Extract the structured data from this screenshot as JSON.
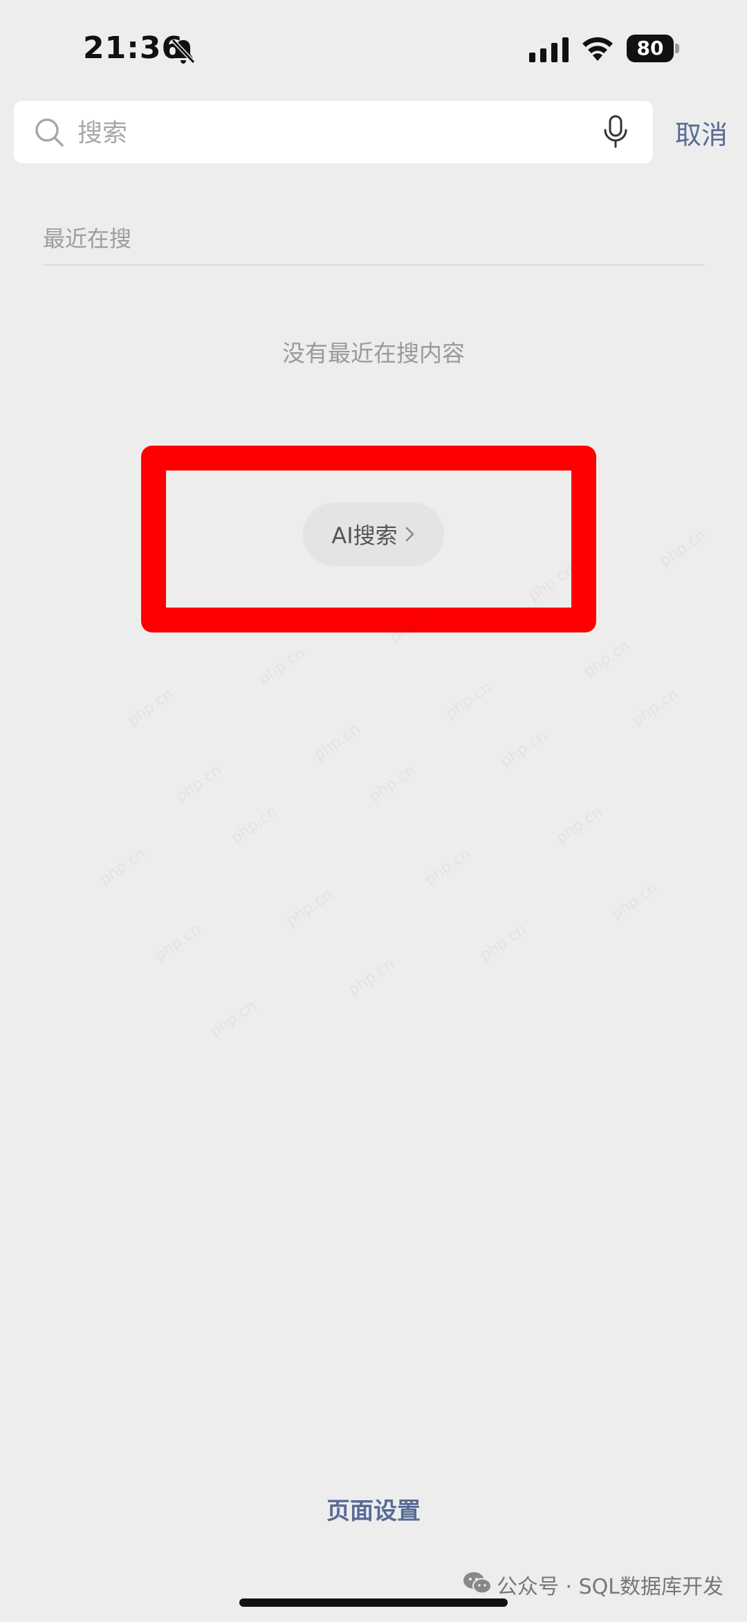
{
  "status_bar": {
    "time": "21:36",
    "battery_level": "80",
    "icons": [
      "bell-mute-icon",
      "cellular-signal-icon",
      "wifi-icon",
      "battery-icon"
    ]
  },
  "search": {
    "placeholder": "搜索",
    "value": "",
    "cancel_label": "取消",
    "icons": [
      "search-icon",
      "microphone-icon"
    ]
  },
  "recent": {
    "title": "最近在搜",
    "empty_message": "没有最近在搜内容"
  },
  "ai_search": {
    "label": "AI搜索",
    "icon": "chevron-right-icon"
  },
  "highlight": {
    "color": "#ff0000"
  },
  "footer": {
    "page_settings_label": "页面设置",
    "credit": "公众号 · SQL数据库开发",
    "icons": [
      "wechat-icon"
    ]
  },
  "watermark": {
    "text": "php.cn"
  },
  "colors": {
    "background": "#ededed",
    "link": "#576b95",
    "muted_text": "#9d9d9d"
  }
}
